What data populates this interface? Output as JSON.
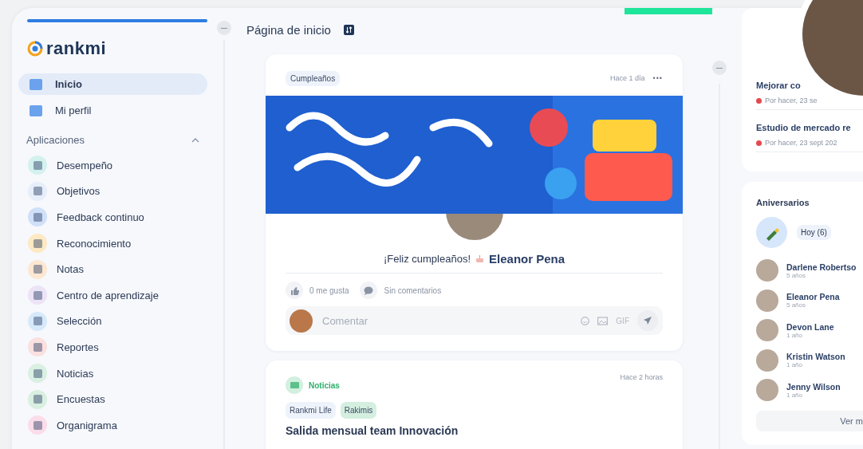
{
  "sidebar": {
    "progress": {
      "level": 1
    },
    "logo": "rankmi",
    "nav": [
      {
        "label": "Inicio",
        "selected": true
      },
      {
        "label": "Mi perfil",
        "selected": false
      }
    ],
    "section": {
      "title": "Aplicaciones",
      "expanded": true
    },
    "apps": [
      {
        "label": "Desempeño",
        "color": "#d3f1ee"
      },
      {
        "label": "Objetivos",
        "color": "#e6eef9"
      },
      {
        "label": "Feedback continuo",
        "color": "#cfe0f8"
      },
      {
        "label": "Reconocimiento",
        "color": "#fde9c4"
      },
      {
        "label": "Notas",
        "color": "#fde7d2"
      },
      {
        "label": "Centro de aprendizaje",
        "color": "#ece3f6"
      },
      {
        "label": "Selección",
        "color": "#d6e9fb"
      },
      {
        "label": "Reportes",
        "color": "#fbe0e0"
      },
      {
        "label": "Noticias",
        "color": "#d9f0e2"
      },
      {
        "label": "Encuestas",
        "color": "#d9efe0"
      },
      {
        "label": "Organigrama",
        "color": "#fbdde9"
      }
    ]
  },
  "header": {
    "title": "Página de inicio"
  },
  "birthday_post": {
    "tag": "Cumpleaños",
    "time": "Hace 1 día",
    "more": "•••",
    "greeting": "¡Feliz cumpleaños!",
    "name": "Eleanor Pena",
    "likes": "0 me gusta",
    "comments": "Sin comentarios",
    "comment_placeholder": "Comentar",
    "gif": "GIF"
  },
  "news_post": {
    "tag": "Noticias",
    "time": "Hace 2 horas",
    "labels": [
      "Rankmi Life",
      "Rakimis"
    ],
    "title": "Salida mensual team Innovación"
  },
  "tasks": [
    {
      "title": "Mejorar co",
      "status": "Por hacer, 23 se",
      "color": "#e5484d"
    },
    {
      "title": "Estudio de mercado re",
      "status": "Por hacer, 23 sept 202",
      "color": "#e5484d"
    }
  ],
  "anniversaries": {
    "title": "Aniversarios",
    "today": "Hoy (6)",
    "people": [
      {
        "name": "Darlene Robertso",
        "years": "5 años"
      },
      {
        "name": "Eleanor Pena",
        "years": "5 años"
      },
      {
        "name": "Devon Lane",
        "years": "1 año"
      },
      {
        "name": "Kristin Watson",
        "years": "1 año"
      },
      {
        "name": "Jenny Wilson",
        "years": "1 año"
      }
    ],
    "button": "Ver m"
  }
}
